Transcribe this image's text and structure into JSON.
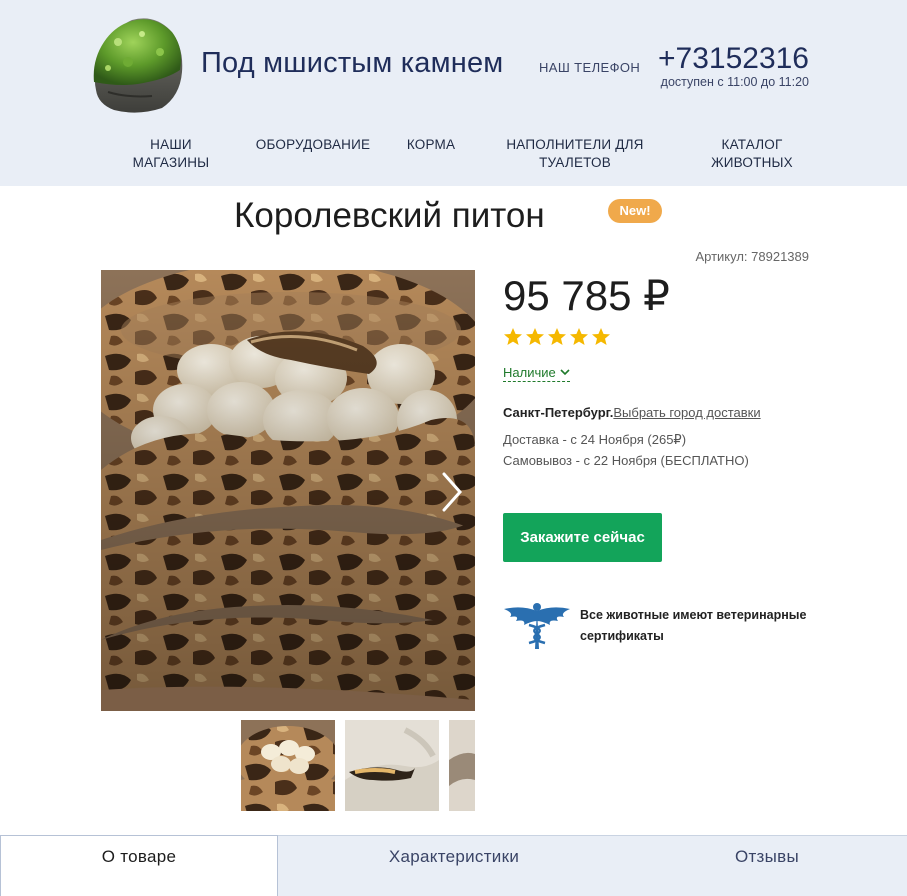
{
  "header": {
    "brand": "Под мшистым камнем",
    "phone_label": "НАШ ТЕЛЕФОН",
    "phone": "+73152316",
    "phone_hours": "доступен с 11:00 до 11:20"
  },
  "nav": {
    "items": [
      {
        "line1": "НАШИ",
        "line2": "МАГАЗИНЫ"
      },
      {
        "line1": "ОБОРУДОВАНИЕ",
        "line2": ""
      },
      {
        "line1": "КОРМА",
        "line2": ""
      },
      {
        "line1": "НАПОЛНИТЕЛИ ДЛЯ",
        "line2": "ТУАЛЕТОВ"
      },
      {
        "line1": "КАТАЛОГ",
        "line2": "ЖИВОТНЫХ"
      }
    ]
  },
  "product": {
    "title": "Королевский питон",
    "badge": "New!",
    "sku": "Артикул: 78921389",
    "price": "95 785 ₽",
    "rating": 5,
    "availability": "Наличие",
    "city": "Санкт-Петербург.",
    "city_link": "Выбрать город доставки",
    "delivery": "Доставка - с 24 Ноября (265₽)",
    "pickup": "Самовывоз - с 22 Ноября (БЕСПЛАТНО)",
    "order_button": "Закажите сейчас",
    "vet_text": "Все животные имеют ветеринарные сертификаты"
  },
  "colors": {
    "header_bg": "#e9eef6",
    "brand_text": "#1f2d5a",
    "badge": "#f0a94b",
    "order_button": "#13a45a",
    "availability": "#1f7a2b",
    "stars": "#f5b800",
    "vet_icon": "#2a6fb0"
  },
  "icons": [
    "moss-stone-logo",
    "chevron-right-icon",
    "star-icon",
    "chevron-down-icon",
    "caduceus-wings-icon"
  ],
  "tabs": [
    {
      "label": "О товаре",
      "active": true
    },
    {
      "label": "Характеристики",
      "active": false
    },
    {
      "label": "Отзывы",
      "active": false
    }
  ]
}
